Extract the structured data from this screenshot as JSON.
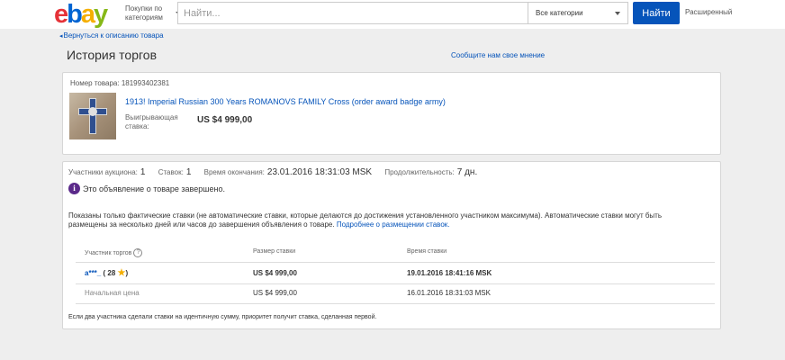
{
  "header": {
    "logo": {
      "e": "e",
      "b": "b",
      "a": "a",
      "y": "y"
    },
    "shop_by_category": "Покупки по категориям",
    "search_placeholder": "Найти...",
    "category_select": "Все категории",
    "search_button": "Найти",
    "advanced_link": "Расширенный"
  },
  "nav": {
    "back_link": "Вернуться к описанию товара"
  },
  "page": {
    "title": "История торгов",
    "feedback_link": "Сообщите нам свое мнение"
  },
  "item": {
    "number_label": "Номер товара: 181993402381",
    "title": "1913! Imperial Russian 300 Years ROMANOVS FAMILY Cross (order award badge army)",
    "winning_bid_label": "Выигрывающая ставка:",
    "winning_bid_value": "US $4 999,00"
  },
  "summary": {
    "bidders_label": "Участники аукциона:",
    "bidders_value": "1",
    "bids_label": "Ставок:",
    "bids_value": "1",
    "end_label": "Время окончания:",
    "end_value": "23.01.2016 18:31:03 MSK",
    "duration_label": "Продолжительность:",
    "duration_value": "7 дн."
  },
  "ended_message": "Это объявление о товаре завершено.",
  "note": {
    "text": "Показаны только фактические ставки (не автоматические ставки, которые делаются до достижения установленного участником максимума). Автоматические ставки могут быть размещены за несколько дней или часов до завершения объявления о товаре.",
    "link": "Подробнее о размещении ставок."
  },
  "table": {
    "headers": {
      "bidder": "Участник торгов",
      "amount": "Размер ставки",
      "time": "Время ставки"
    },
    "rows": [
      {
        "bidder": "a***_",
        "feedback": "( 28",
        "feedback_close": ")",
        "amount": "US $4 999,00",
        "time": "19.01.2016 18:41:16 MSK"
      },
      {
        "bidder": "Начальная цена",
        "amount": "US $4 999,00",
        "time": "16.01.2016 18:31:03 MSK"
      }
    ]
  },
  "footnote": "Если два участника сделали ставки на идентичную сумму, приоритет получит ставка, сделанная первой.",
  "icons": {
    "info": "i",
    "help": "?",
    "star": "★"
  }
}
